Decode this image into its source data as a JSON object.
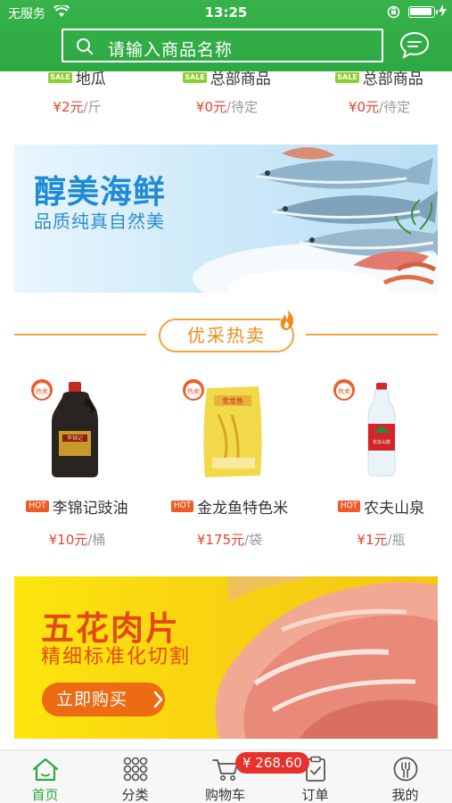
{
  "status_bar": {
    "carrier": "无服务",
    "time": "13:25"
  },
  "search": {
    "placeholder": "请输入商品名称"
  },
  "top_products": [
    {
      "tag": "SALE",
      "name": "地瓜",
      "price": "¥2元",
      "unit": "/斤"
    },
    {
      "tag": "SALE",
      "name": "总部商品",
      "price": "¥0元",
      "unit": "/待定"
    },
    {
      "tag": "SALE",
      "name": "总部商品",
      "price": "¥0元",
      "unit": "/待定"
    }
  ],
  "banner_seafood": {
    "title": "醇美海鲜",
    "subtitle": "品质纯真自然美"
  },
  "section": {
    "title": "优采热卖"
  },
  "hot_products": [
    {
      "badge": "热卖",
      "tag": "HOT",
      "name": "李锦记豉油",
      "price": "¥10元",
      "unit": "/桶",
      "image_label": "李锦记"
    },
    {
      "badge": "热卖",
      "tag": "HOT",
      "name": "金龙鱼特色米",
      "price": "¥175元",
      "unit": "/袋",
      "image_label": "金龙鱼"
    },
    {
      "badge": "热卖",
      "tag": "HOT",
      "name": "农夫山泉",
      "price": "¥1元",
      "unit": "/瓶",
      "image_label": "农夫山泉"
    }
  ],
  "banner_pork": {
    "title": "五花肉片",
    "subtitle": "精细标准化切割",
    "button": "立即购买"
  },
  "tabbar": {
    "tabs": [
      {
        "label": "首页",
        "icon": "home-icon"
      },
      {
        "label": "分类",
        "icon": "grid-icon"
      },
      {
        "label": "购物车",
        "icon": "cart-icon"
      },
      {
        "label": "订单",
        "icon": "clipboard-icon"
      },
      {
        "label": "我的",
        "icon": "user-icon"
      }
    ],
    "cart_total": "¥ 268.60"
  },
  "colors": {
    "brand_green": "#2ea843",
    "price_red": "#e2452f",
    "accent_orange": "#f5a23c",
    "badge_red": "#e8312a"
  }
}
